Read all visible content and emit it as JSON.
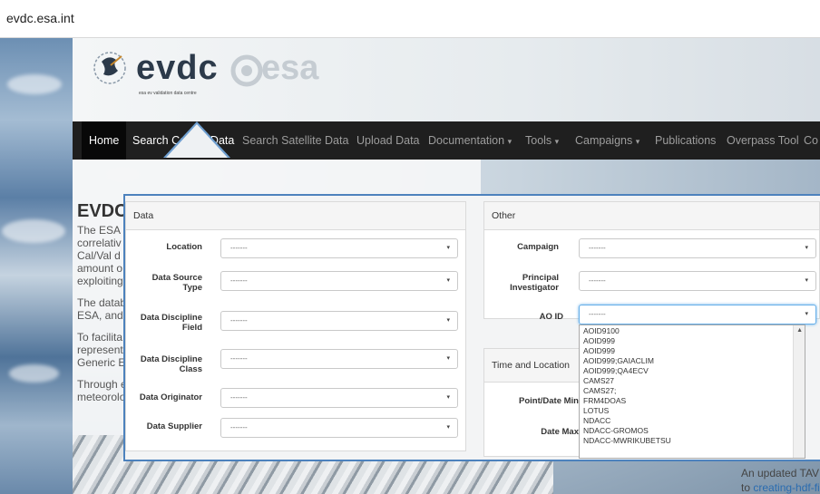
{
  "browser": {
    "url": "evdc.esa.int"
  },
  "header": {
    "logo_text": "evdc",
    "logo_subtitle": "esa ev validation data centre",
    "esa_logo_text": "esa"
  },
  "nav": {
    "home": "Home",
    "search_calval": "Search Cal/Val Data",
    "search_satellite": "Search Satellite Data",
    "upload": "Upload Data",
    "documentation": "Documentation",
    "tools": "Tools",
    "campaigns": "Campaigns",
    "publications": "Publications",
    "overpass": "Overpass Tool",
    "more": "Co",
    "caret": "▾"
  },
  "page": {
    "heading": "EVDC",
    "p1": [
      "The ESA",
      "correlativ",
      "Cal/Val d",
      "amount o",
      "exploiting"
    ],
    "p2": [
      "The datab",
      "ESA, and"
    ],
    "p3": [
      "To facilita",
      "represent",
      "Generic E"
    ],
    "p4": [
      "Through e",
      "meteorolo"
    ],
    "tav_line1": "An updated TAV file",
    "tav_line2_prefix": "to ",
    "tav_link": "creating-hdf-files/"
  },
  "data_panel": {
    "title": "Data",
    "fields": [
      {
        "label": "Location",
        "value": "-------"
      },
      {
        "label": "Data Source Type",
        "value": "-------"
      },
      {
        "label": "Data Discipline Field",
        "value": "-------"
      },
      {
        "label": "Data Discipline Class",
        "value": "-------"
      },
      {
        "label": "Data Originator",
        "value": "-------"
      },
      {
        "label": "Data Supplier",
        "value": "-------"
      }
    ]
  },
  "other_panel": {
    "title": "Other",
    "campaign": {
      "label": "Campaign",
      "value": "-------"
    },
    "pi": {
      "label": "Principal Investigator",
      "value": "-------"
    },
    "aoid": {
      "label": "AO ID",
      "value": "-------"
    }
  },
  "time_panel": {
    "title": "Time and Location",
    "point_date_min": "Point/Date Min",
    "date_max": "Date Max"
  },
  "aoid_options": [
    "AOID9100",
    "AOID999",
    "AOID999",
    "AOID999;GAIACLIM",
    "AOID999;QA4ECV",
    "CAMS27",
    "CAMS27;",
    "FRM4DOAS",
    "LOTUS",
    "NDACC",
    "NDACC-GROMOS",
    "NDACC-MWRIKUBETSU"
  ],
  "icons": {
    "arrow": "▾",
    "scroll_up": "▲"
  }
}
